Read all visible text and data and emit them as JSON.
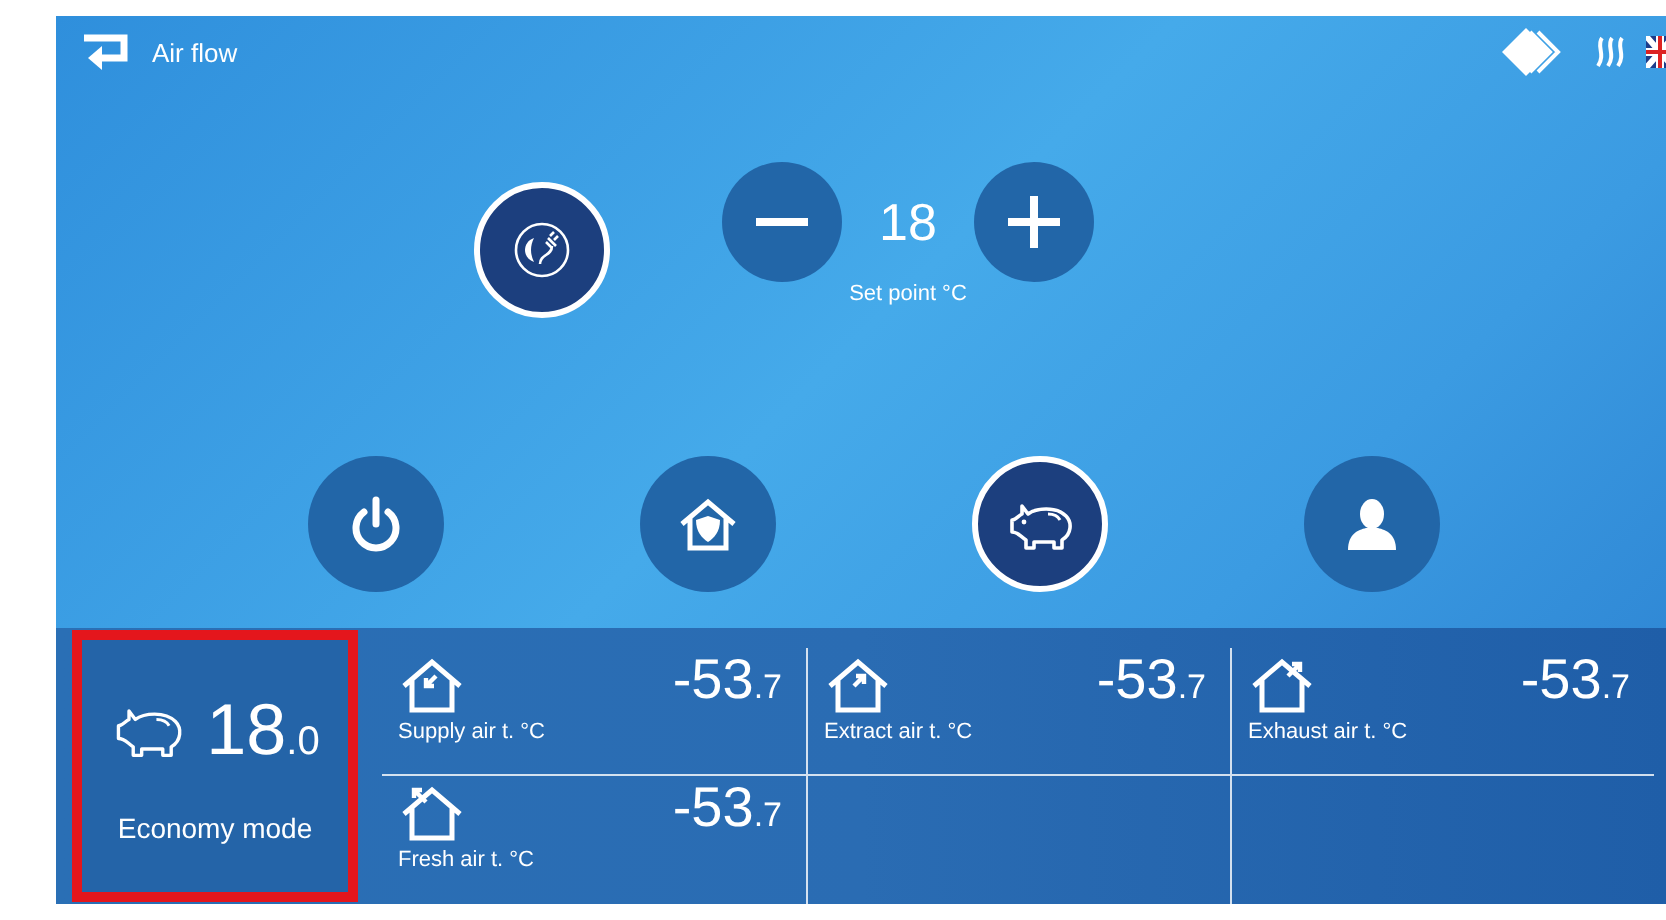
{
  "header": {
    "title": "Air flow"
  },
  "setpoint": {
    "value": "18",
    "label": "Set point °C"
  },
  "top_mode": {
    "kind": "eco",
    "selected": true
  },
  "modes": [
    {
      "kind": "power",
      "selected": false
    },
    {
      "kind": "home",
      "selected": false
    },
    {
      "kind": "economy",
      "selected": true
    },
    {
      "kind": "user",
      "selected": false
    }
  ],
  "active_mode": {
    "value": "18",
    "decimal": ".0",
    "label": "Economy mode",
    "highlighted": true
  },
  "readings": [
    {
      "kind": "supply",
      "value": "-53",
      "decimal": ".7",
      "label": "Supply air t. °C"
    },
    {
      "kind": "extract",
      "value": "-53",
      "decimal": ".7",
      "label": "Extract air t. °C"
    },
    {
      "kind": "exhaust",
      "value": "-53",
      "decimal": ".7",
      "label": "Exhaust air t. °C"
    },
    {
      "kind": "fresh",
      "value": "-53",
      "decimal": ".7",
      "label": "Fresh air t. °C"
    }
  ]
}
